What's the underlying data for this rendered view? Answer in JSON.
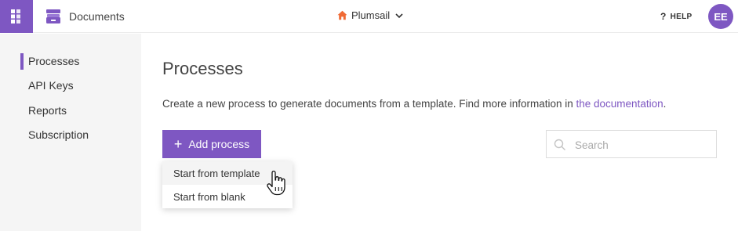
{
  "app": {
    "title": "Documents"
  },
  "header": {
    "tenant_name": "Plumsail",
    "help_label": "HELP",
    "help_icon": "question-mark",
    "avatar_initials": "EE"
  },
  "sidebar": {
    "items": [
      {
        "label": "Processes",
        "active": true
      },
      {
        "label": "API Keys",
        "active": false
      },
      {
        "label": "Reports",
        "active": false
      },
      {
        "label": "Subscription",
        "active": false
      }
    ]
  },
  "main": {
    "title": "Processes",
    "description_prefix": "Create a new process to generate documents from a template. Find more information in ",
    "description_link": "the documentation",
    "description_suffix": ".",
    "add_button_label": "Add process",
    "search_placeholder": "Search",
    "add_menu": [
      {
        "label": "Start from template"
      },
      {
        "label": "Start from blank"
      }
    ]
  },
  "colors": {
    "accent": "#7e57c2",
    "home_icon": "#f06a35",
    "sidebar_bg": "#f5f5f5"
  }
}
